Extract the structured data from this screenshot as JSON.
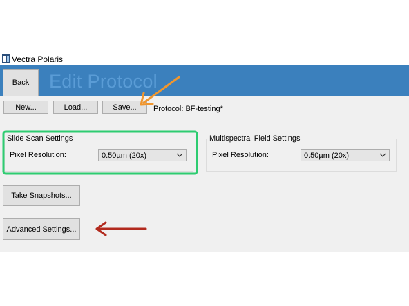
{
  "window": {
    "title": "Vectra Polaris"
  },
  "header": {
    "back_label": "Back",
    "page_title": "Edit Protocol"
  },
  "toolbar": {
    "new_label": "New...",
    "load_label": "Load...",
    "save_label": "Save...",
    "protocol_text": "Protocol: BF-testing*"
  },
  "slide_scan": {
    "title": "Slide Scan Settings",
    "pixel_label": "Pixel Resolution:",
    "pixel_value": "0.50µm (20x)"
  },
  "multispectral": {
    "title": "Multispectral Field Settings",
    "pixel_label": "Pixel Resolution:",
    "pixel_value": "0.50µm (20x)"
  },
  "actions": {
    "snapshots_label": "Take Snapshots...",
    "advanced_label": "Advanced Settings..."
  },
  "colors": {
    "header_band": "#3b80bd",
    "highlight_box": "#2ecc71",
    "orange_arrow": "#f0962e",
    "red_arrow": "#b22a1e"
  },
  "icons": {
    "app": "vectra-app-icon",
    "dropdown": "chevron-down-icon"
  }
}
